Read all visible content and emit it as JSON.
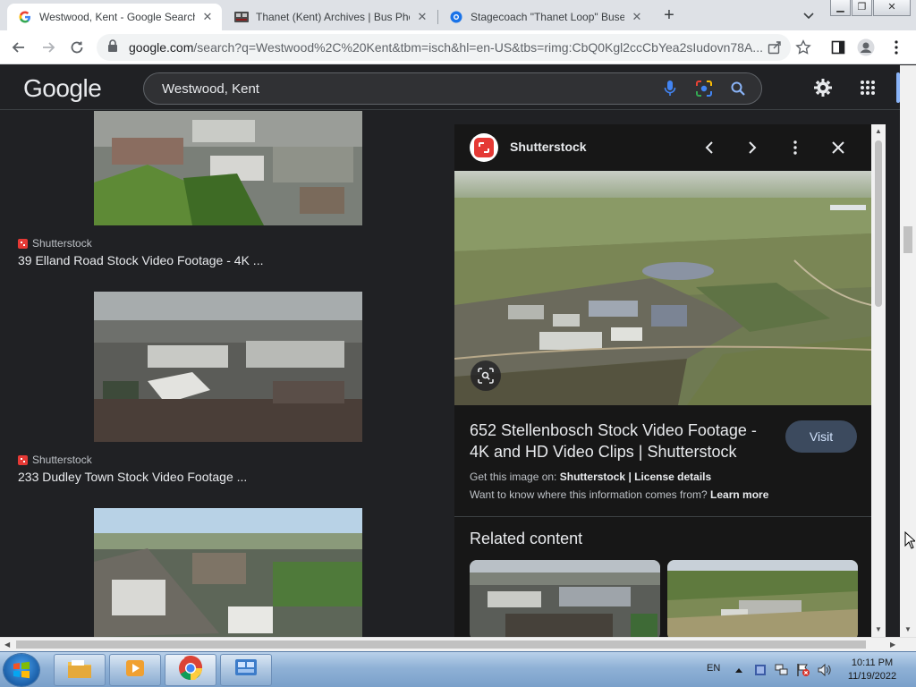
{
  "browser": {
    "tabs": [
      {
        "title": "Westwood, Kent - Google Search",
        "active": true
      },
      {
        "title": "Thanet (Kent) Archives | Bus Phot",
        "active": false
      },
      {
        "title": "Stagecoach \"Thanet Loop\" Buses",
        "active": false
      }
    ],
    "new_tab_label": "+",
    "url_host": "google.com",
    "url_path": "/search?q=Westwood%2C%20Kent&tbm=isch&hl=en-US&tbs=rimg:CbQ0Kgl2ccCbYea2sIudovn78A..."
  },
  "google": {
    "logo": "Google",
    "query": "Westwood, Kent"
  },
  "results": [
    {
      "source": "Shutterstock",
      "title": "39 Elland Road Stock Video Footage - 4K ..."
    },
    {
      "source": "Shutterstock",
      "title": "233 Dudley Town Stock Video Footage ..."
    }
  ],
  "panel": {
    "source": "Shutterstock",
    "title": "652 Stellenbosch Stock Video Footage - 4K and HD Video Clips | Shutterstock",
    "visit_label": "Visit",
    "get_image_prefix": "Get this image on:",
    "get_image_source": "Shutterstock",
    "get_image_sep": "|",
    "license_label": "License details",
    "want_know": "Want to know where this information comes from?",
    "learn_more": "Learn more",
    "related_heading": "Related content"
  },
  "taskbar": {
    "language": "EN",
    "time": "10:11 PM",
    "date": "11/19/2022"
  }
}
